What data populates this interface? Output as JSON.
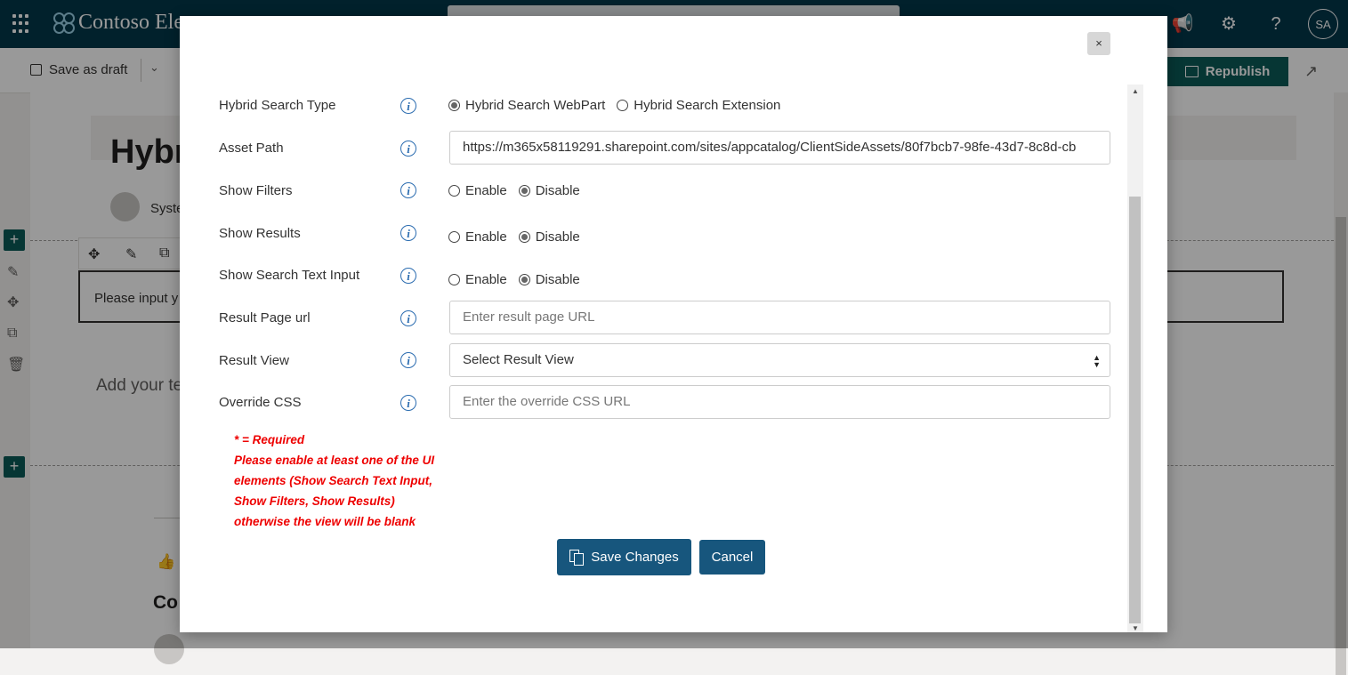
{
  "suite": {
    "brand": "Contoso Ele",
    "avatar_initials": "SA"
  },
  "command_bar": {
    "save_draft_label": "Save as draft",
    "republish_label": "Republish"
  },
  "page": {
    "title": "Hybr",
    "author": "Syste",
    "input_hint": "Please input y",
    "add_text": "Add your te",
    "comments_heading": "Co"
  },
  "modal": {
    "close_label": "×",
    "fields": {
      "search_type": {
        "label": "Hybrid Search Type",
        "options": [
          "Hybrid Search WebPart",
          "Hybrid Search Extension"
        ],
        "selected": "Hybrid Search WebPart"
      },
      "asset_path": {
        "label": "Asset Path",
        "value": "https://m365x58119291.sharepoint.com/sites/appcatalog/ClientSideAssets/80f7bcb7-98fe-43d7-8c8d-cb"
      },
      "show_filters": {
        "label": "Show Filters",
        "options": [
          "Enable",
          "Disable"
        ],
        "selected": "Disable"
      },
      "show_results": {
        "label": "Show Results",
        "options": [
          "Enable",
          "Disable"
        ],
        "selected": "Disable"
      },
      "show_search_text_input": {
        "label": "Show Search Text Input",
        "options": [
          "Enable",
          "Disable"
        ],
        "selected": "Disable"
      },
      "result_page_url": {
        "label": "Result Page url",
        "placeholder": "Enter result page URL",
        "value": ""
      },
      "result_view": {
        "label": "Result View",
        "selected": "Select Result View"
      },
      "override_css": {
        "label": "Override CSS",
        "placeholder": "Enter the override CSS URL",
        "value": ""
      }
    },
    "notes": {
      "required": "* = Required",
      "warning": "Please enable at least one of the UI elements (Show Search Text Input, Show Filters, Show Results) otherwise the view will be blank"
    },
    "buttons": {
      "save": "Save Changes",
      "cancel": "Cancel"
    }
  },
  "colors": {
    "suite_bar": "#03374a",
    "accent_green": "#0b5a58",
    "button_blue": "#17567d",
    "warning_red": "#ee0000",
    "info_blue": "#2b6cb0"
  }
}
